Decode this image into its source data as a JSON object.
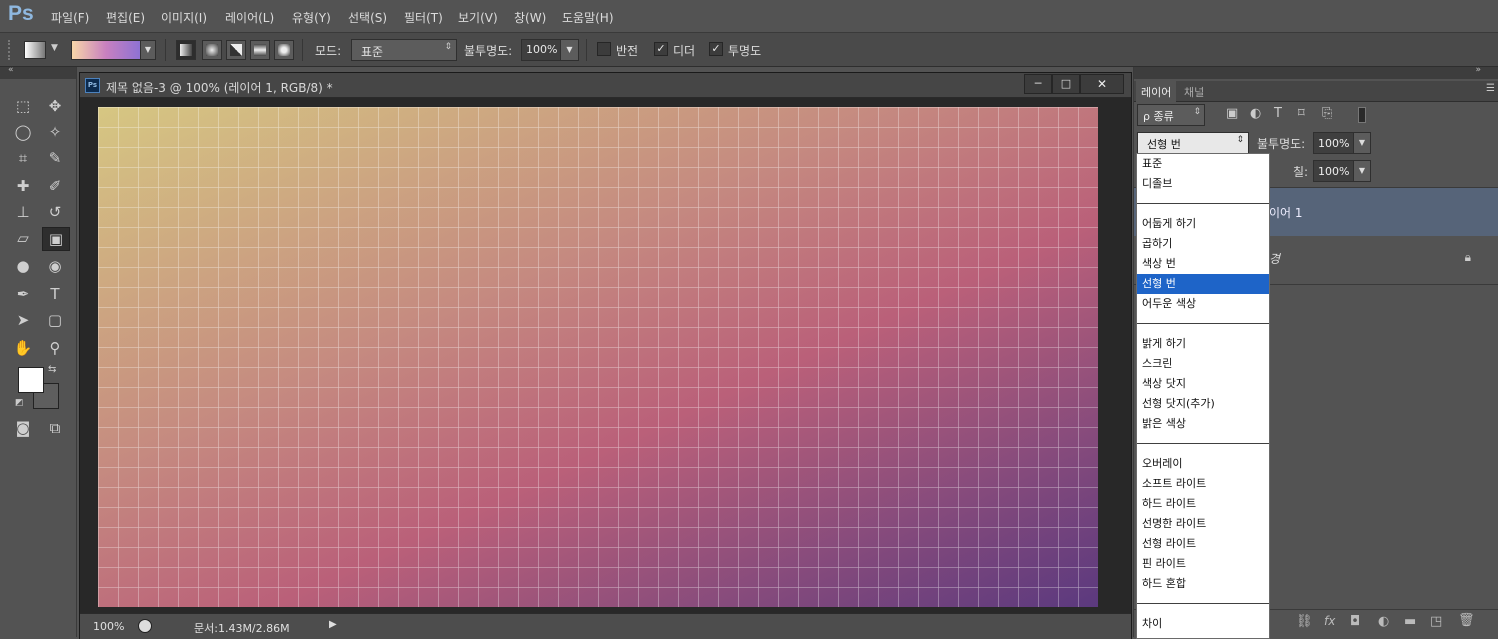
{
  "app": {
    "logo": "Ps"
  },
  "menu": [
    "파일(F)",
    "편집(E)",
    "이미지(I)",
    "레이어(L)",
    "유형(Y)",
    "선택(S)",
    "필터(T)",
    "보기(V)",
    "창(W)",
    "도움말(H)"
  ],
  "options": {
    "mode_label": "모드:",
    "mode_value": "표준",
    "opacity_label": "불투명도:",
    "opacity_value": "100%",
    "reverse_label": "반전",
    "dither_label": "디더",
    "transparency_label": "투명도",
    "gradient_colors": [
      "#f7d6a8",
      "#c880c0",
      "#8e72d4"
    ]
  },
  "document": {
    "title": "제목 없음-3 @ 100% (레이어 1, RGB/8) *",
    "zoom": "100%",
    "doc_size": "문서:1.43M/2.86M",
    "window_buttons": [
      "─",
      "□",
      "✕"
    ]
  },
  "layers_panel": {
    "tabs": [
      "레이어",
      "채널"
    ],
    "filter_label": "ρ 종류",
    "blend_value": "선형 번",
    "opacity_label": "불투명도:",
    "opacity_value": "100%",
    "fill_label": "칠:",
    "fill_value": "100%",
    "layers": [
      {
        "name": "이어 1"
      },
      {
        "name": "경"
      }
    ]
  },
  "blend_dropdown": {
    "items": [
      {
        "label": "표준"
      },
      {
        "label": "디졸브"
      },
      {
        "sep": true
      },
      {
        "label": "어둡게 하기"
      },
      {
        "label": "곱하기"
      },
      {
        "label": "색상 번"
      },
      {
        "label": "선형 번",
        "selected": true
      },
      {
        "label": "어두운 색상"
      },
      {
        "sep": true
      },
      {
        "label": "밝게 하기"
      },
      {
        "label": "스크린"
      },
      {
        "label": "색상 닷지"
      },
      {
        "label": "선형 닷지(추가)"
      },
      {
        "label": "밝은 색상"
      },
      {
        "sep": true
      },
      {
        "label": "오버레이"
      },
      {
        "label": "소프트 라이트"
      },
      {
        "label": "하드 라이트"
      },
      {
        "label": "선명한 라이트"
      },
      {
        "label": "선형 라이트"
      },
      {
        "label": "핀 라이트"
      },
      {
        "label": "하드 혼합"
      },
      {
        "sep": true
      },
      {
        "label": "차이"
      }
    ]
  }
}
